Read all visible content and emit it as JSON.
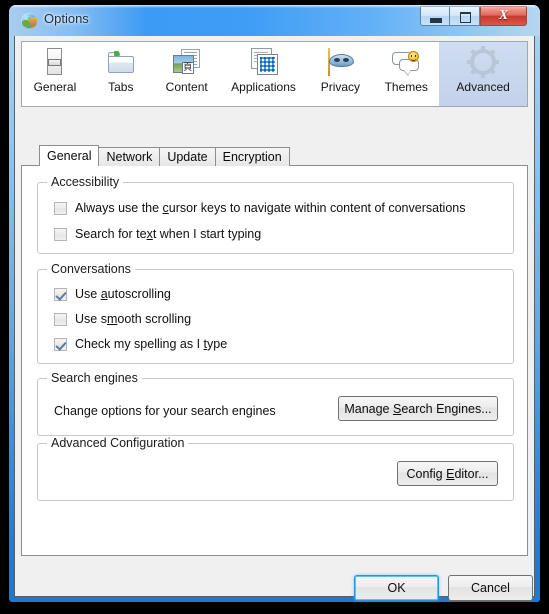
{
  "window": {
    "title": "Options",
    "icon": "globe-icon",
    "caption_buttons": {
      "minimize": "minimize-icon",
      "maximize": "maximize-icon",
      "close": "X"
    }
  },
  "toolbar": {
    "items": [
      {
        "label": "General",
        "icon": "general-icon",
        "selected": false
      },
      {
        "label": "Tabs",
        "icon": "tabs-icon",
        "selected": false
      },
      {
        "label": "Content",
        "icon": "content-icon",
        "selected": false
      },
      {
        "label": "Applications",
        "icon": "applications-icon",
        "selected": false
      },
      {
        "label": "Privacy",
        "icon": "privacy-mask-icon",
        "selected": false
      },
      {
        "label": "Themes",
        "icon": "themes-icon",
        "selected": false
      },
      {
        "label": "Advanced",
        "icon": "gear-icon",
        "selected": true
      }
    ]
  },
  "tabs": [
    {
      "label": "General",
      "active": true
    },
    {
      "label": "Network",
      "active": false
    },
    {
      "label": "Update",
      "active": false
    },
    {
      "label": "Encryption",
      "active": false
    }
  ],
  "groups": {
    "accessibility": {
      "legend": "Accessibility",
      "options": [
        {
          "label_before": "Always use the ",
          "accel": "c",
          "label_after": "ursor keys to navigate within content of conversations",
          "checked": false
        },
        {
          "label_before": "Search for te",
          "accel": "x",
          "label_after": "t when I start typing",
          "checked": false
        }
      ]
    },
    "conversations": {
      "legend": "Conversations",
      "options": [
        {
          "label_before": "Use ",
          "accel": "a",
          "label_after": "utoscrolling",
          "checked": true
        },
        {
          "label_before": "Use s",
          "accel": "m",
          "label_after": "ooth scrolling",
          "checked": false
        },
        {
          "label_before": "Check my spelling as I ",
          "accel": "t",
          "label_after": "ype",
          "checked": true
        }
      ]
    },
    "search_engines": {
      "legend": "Search engines",
      "description": "Change options for your search engines",
      "button": {
        "label_before": "Manage ",
        "accel": "S",
        "label_after": "earch Engines..."
      }
    },
    "advanced_configuration": {
      "legend": "Advanced Configuration",
      "button": {
        "label_before": "Config ",
        "accel": "E",
        "label_after": "ditor..."
      }
    }
  },
  "dialog_buttons": {
    "ok": "OK",
    "cancel": "Cancel"
  },
  "colors": {
    "frame_top": "#a9d1f2",
    "frame_bottom": "#1a7ada",
    "titlebar_accent": "#3f9df6",
    "close_button": "#c63a2c",
    "selected_tool": "#c3d2ea",
    "checkmark": "#5b7ca0",
    "default_button_focus": "#2f92d8",
    "panel_bg": "#ffffff",
    "client_bg": "#f0f0f0"
  }
}
